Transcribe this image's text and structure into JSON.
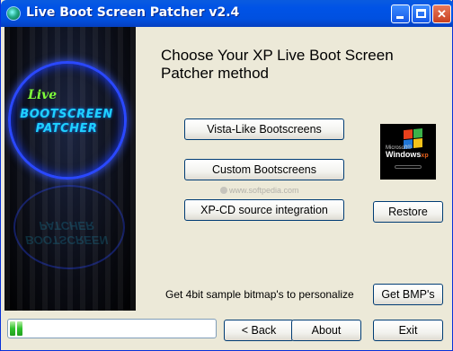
{
  "window": {
    "title": "Live Boot Screen Patcher v2.4"
  },
  "logo": {
    "line1": "Live",
    "line2": "BOOTSCREEN",
    "line3": "PATCHER"
  },
  "main": {
    "heading": "Choose Your XP Live Boot Screen Patcher method",
    "buttons": {
      "vista": "Vista-Like Bootscreens",
      "custom": "Custom Bootscreens",
      "xpcd": "XP-CD source integration",
      "restore": "Restore",
      "get_bmp": "Get BMP's"
    },
    "hint": "Get 4bit sample bitmap's to personalize",
    "watermark": "www.softpedia.com",
    "preview": {
      "microsoft": "Microsoft®",
      "windows": "Windows",
      "xp": "xp"
    }
  },
  "footer": {
    "progress_percent": 4,
    "back_label": "< Back",
    "about_label": "About",
    "exit_label": "Exit"
  },
  "colors": {
    "titlebar": "#0053e6",
    "progress_green": "#2fc22b",
    "logo_blue": "#20d0ff",
    "logo_green": "#7fff3a"
  }
}
